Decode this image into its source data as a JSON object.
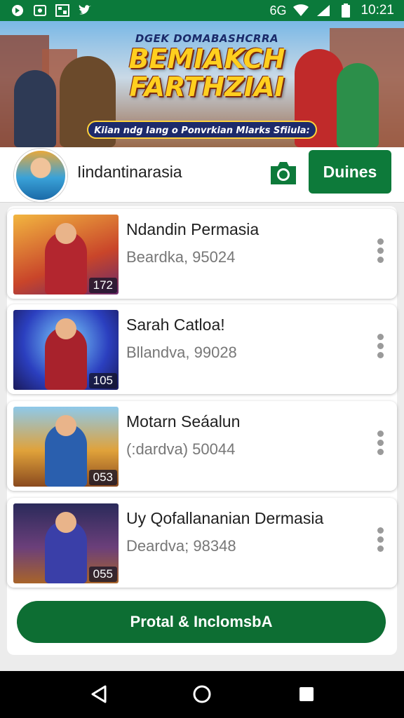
{
  "status_bar": {
    "time": "10:21",
    "network": "6G",
    "left_icons": [
      "app-notification-icon",
      "download-icon",
      "qr-icon",
      "twitter-icon"
    ],
    "right_icons": [
      "wifi-icon",
      "signal-icon",
      "battery-icon"
    ]
  },
  "banner": {
    "supertitle": "DGEK DOMABASHCRRA",
    "title_line1": "BEMIAKCH",
    "title_line2": "FARTHZIAI",
    "subtitle": "Kiian ndg Iang o Ponvrkian Mlarks Sfiiula:"
  },
  "profile": {
    "name": "Iindantinarasia",
    "follow_label": "Duines"
  },
  "cards": [
    {
      "title": "Ndandin Permasia",
      "subtitle": "Beardka,  95024",
      "count": "172"
    },
    {
      "title": "Sarah Catloa!",
      "subtitle": "Bllandva,  99028",
      "count": "105"
    },
    {
      "title": "Motarn Seáalun",
      "subtitle": "(:dardva)  50044",
      "count": "053"
    },
    {
      "title": "Uy Qofallananian Dermasia",
      "subtitle": "Deardva;  98348",
      "count": "055"
    }
  ],
  "cta_label": "Protal & InclomsbA",
  "colors": {
    "brand_green": "#0d7a3a",
    "status_bar": "#0b7a3b"
  }
}
